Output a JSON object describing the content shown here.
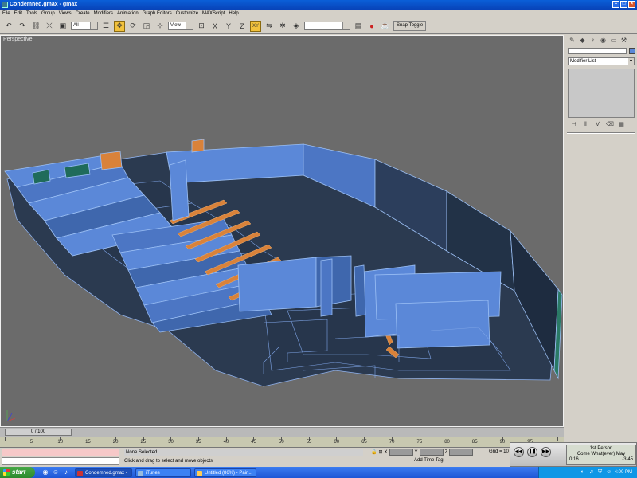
{
  "window": {
    "title": "Condemned.gmax - gmax"
  },
  "menu": [
    "File",
    "Edit",
    "Tools",
    "Group",
    "Views",
    "Create",
    "Modifiers",
    "Animation",
    "Graph Editors",
    "Customize",
    "MAXScript",
    "Help"
  ],
  "toolbar": {
    "selection_filter": "All",
    "ref_coord": "View",
    "named_selection": "",
    "snap_toggle_label": "Snap Toggle",
    "snap_active": "XY"
  },
  "viewport": {
    "label": "Perspective",
    "colors": {
      "background": "#6b6b6b",
      "geometry": "#5b88d8",
      "accent": "#d9823a"
    }
  },
  "command_panel": {
    "modifier_list": "Modifier List",
    "object_name": ""
  },
  "timeline": {
    "slider": "0 / 100",
    "ticks": [
      "0",
      "5",
      "10",
      "15",
      "20",
      "25",
      "30",
      "35",
      "40",
      "45",
      "50",
      "55",
      "60",
      "65",
      "70",
      "75",
      "80",
      "85",
      "90",
      "95",
      "100"
    ]
  },
  "status": {
    "selection": "None Selected",
    "prompt": "Click and drag to select and move objects",
    "x_label": "X",
    "y_label": "Y",
    "z_label": "Z",
    "grid": "Grid = 10",
    "add_time_tag": "Add Time Tag"
  },
  "itunes": {
    "line1": "1st Person",
    "line2": "Come What(ever) May",
    "elapsed": "0:16",
    "remaining": "-3:45"
  },
  "taskbar": {
    "start": "start",
    "tasks": [
      "Condemned.gmax - g...",
      "iTunes",
      "Untitled (86%) - Pain..."
    ],
    "clock": "4:00 PM"
  }
}
